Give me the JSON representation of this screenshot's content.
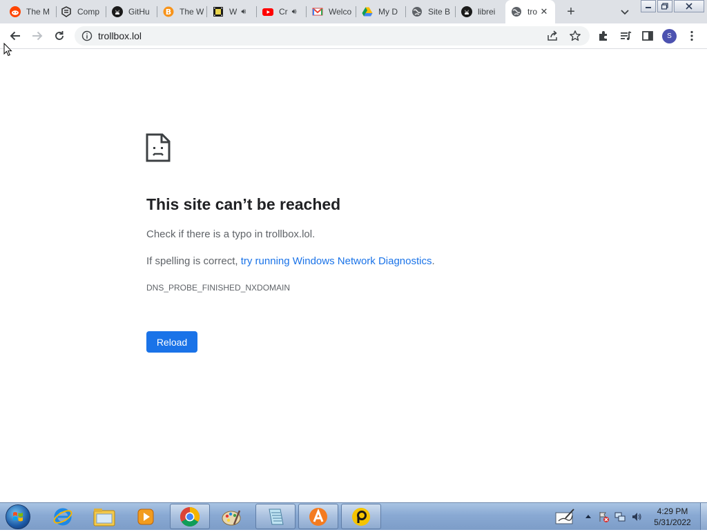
{
  "tabs": [
    {
      "title": "The M",
      "icon": "reddit-icon",
      "color": "#ff4500"
    },
    {
      "title": "Comp",
      "icon": "stack-icon",
      "color": "#333333"
    },
    {
      "title": "GitHu",
      "icon": "github-icon",
      "color": "#1a1a1a"
    },
    {
      "title": "The W",
      "icon": "bitcoin-icon",
      "color": "#f7931a"
    },
    {
      "title": "W",
      "icon": "film-icon",
      "color": "#1a1a1a",
      "audio": true
    },
    {
      "title": "Cr",
      "icon": "youtube-icon",
      "color": "#ff0000",
      "audio": true
    },
    {
      "title": "Welco",
      "icon": "gmail-icon",
      "color": "#ea4335"
    },
    {
      "title": "My D",
      "icon": "drive-icon",
      "color": "#34a853"
    },
    {
      "title": "Site B",
      "icon": "globe-icon",
      "color": "#5f6368"
    },
    {
      "title": "librei",
      "icon": "github-icon",
      "color": "#1a1a1a"
    },
    {
      "title": "tro",
      "icon": "globe-icon",
      "color": "#5f6368",
      "active": true
    }
  ],
  "omnibox": {
    "url": "trollbox.lol"
  },
  "profile": {
    "initial": "S"
  },
  "error": {
    "title": "This site can’t be reached",
    "typo_text": "Check if there is a typo in trollbox.lol.",
    "spelling_prefix": "If spelling is correct, ",
    "spelling_link": "try running Windows Network Diagnostics",
    "spelling_suffix": ".",
    "code": "DNS_PROBE_FINISHED_NXDOMAIN",
    "reload_label": "Reload"
  },
  "taskbar": {
    "items": [
      "ie-icon",
      "explorer-icon",
      "media-player-icon",
      "chrome-icon",
      "paint-icon",
      "notepad-icon",
      "avast-icon",
      "anydesk-icon"
    ],
    "time": "4:29 PM",
    "date": "5/31/2022"
  },
  "colors": {
    "accent": "#1a73e8",
    "tabstrip": "#dee1e6"
  }
}
